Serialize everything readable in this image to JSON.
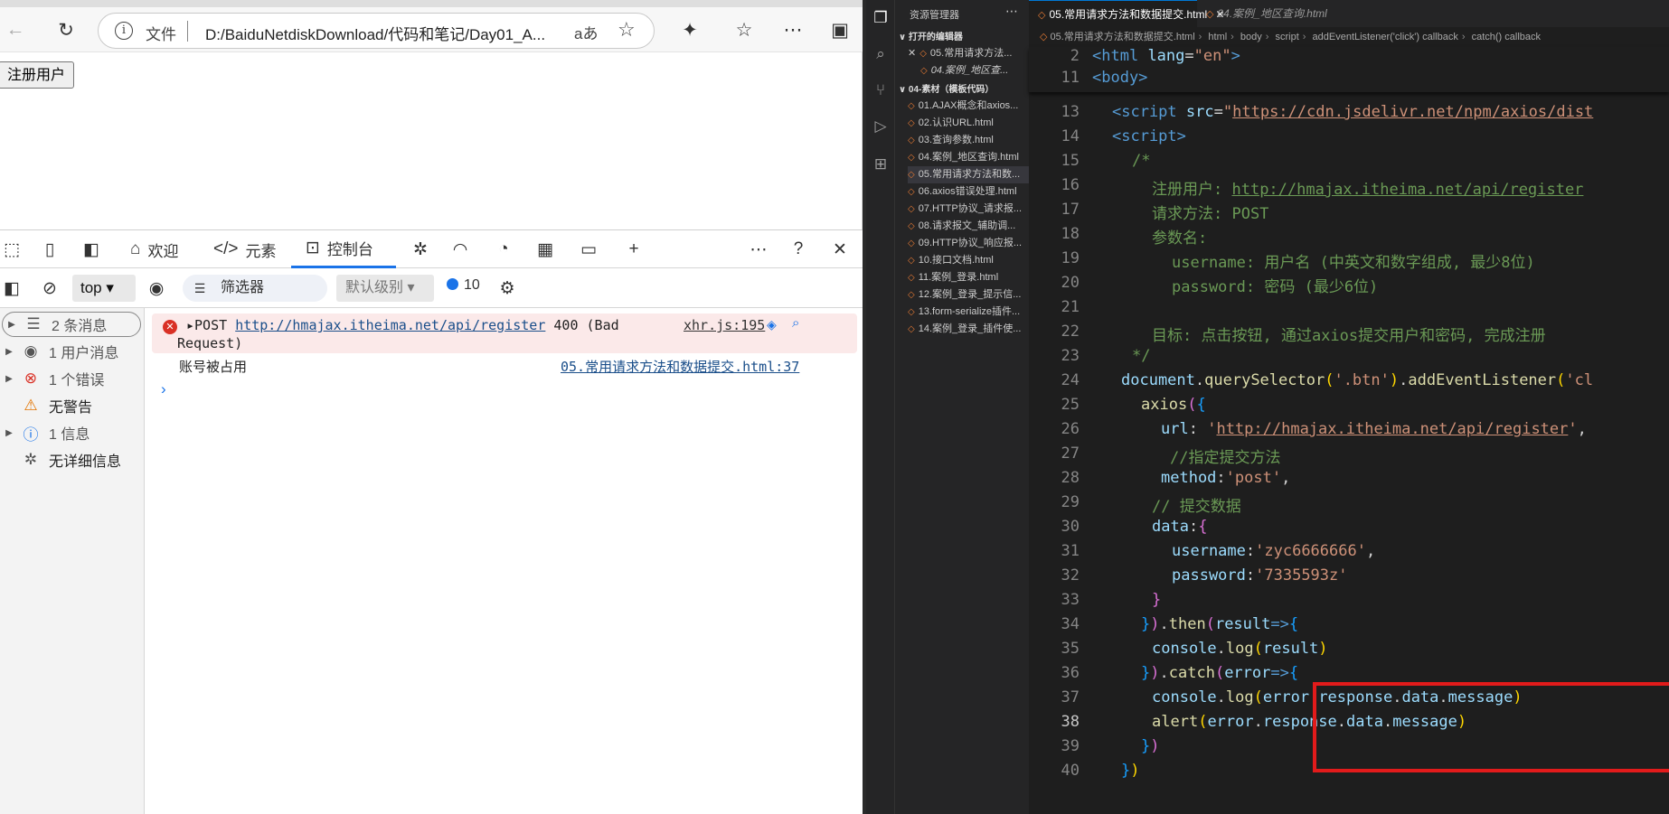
{
  "browser": {
    "address": {
      "label": "文件",
      "url": "D:/BaiduNetdiskDownload/代码和笔记/Day01_A...",
      "read_aloud": "aあ"
    },
    "page": {
      "button_label": "注册用户"
    }
  },
  "devtools": {
    "tabs": [
      {
        "label": "欢迎"
      },
      {
        "label": "元素"
      },
      {
        "label": "控制台"
      }
    ],
    "filter": {
      "context": "top",
      "filter_placeholder": "筛选器",
      "level": "默认级别",
      "count": "10"
    },
    "sidebar": [
      {
        "label": "2 条消息"
      },
      {
        "label": "1 用户消息"
      },
      {
        "label": "1 个错误"
      },
      {
        "label": "无警告"
      },
      {
        "label": "1 信息"
      },
      {
        "label": "无详细信息"
      }
    ],
    "console": {
      "error": {
        "method": "POST",
        "url": "http://hmajax.itheima.net/api/register",
        "status": "400 (Bad",
        "status2": "Request)",
        "source": "xhr.js:195"
      },
      "log": {
        "message": "账号被占用",
        "source": "05.常用请求方法和数据提交.html:37"
      }
    }
  },
  "vscode": {
    "explorer": {
      "title": "资源管理器",
      "open_editors": "打开的编辑器",
      "open_files": [
        {
          "name": "05.常用请求方法..."
        },
        {
          "name": "04.案例_地区查..."
        }
      ],
      "folder": "04-素材（模板代码）",
      "files": [
        {
          "name": "01.AJAX概念和axios..."
        },
        {
          "name": "02.认识URL.html"
        },
        {
          "name": "03.查询参数.html"
        },
        {
          "name": "04.案例_地区查询.html"
        },
        {
          "name": "05.常用请求方法和数..."
        },
        {
          "name": "06.axios错误处理.html"
        },
        {
          "name": "07.HTTP协议_请求报..."
        },
        {
          "name": "08.请求报文_辅助调..."
        },
        {
          "name": "09.HTTP协议_响应报..."
        },
        {
          "name": "10.接口文档.html"
        },
        {
          "name": "11.案例_登录.html"
        },
        {
          "name": "12.案例_登录_提示信..."
        },
        {
          "name": "13.form-serialize插件..."
        },
        {
          "name": "14.案例_登录_插件使..."
        }
      ]
    },
    "tabs": [
      {
        "label": "05.常用请求方法和数据提交.html"
      },
      {
        "label": "04.案例_地区查询.html"
      }
    ],
    "breadcrumb": [
      "05.常用请求方法和数据提交.html",
      "html",
      "body",
      "script",
      "addEventListener('click') callback",
      "catch() callback"
    ],
    "code": {
      "l13_src": "https://cdn.jsdelivr.net/npm/axios/dist",
      "l16": "注册用户: ",
      "l16_url": "http://hmajax.itheima.net/api/register",
      "l17": "请求方法: POST",
      "l18": "参数名:",
      "l19": "username: 用户名 (中英文和数字组成, 最少8位)",
      "l20": "password: 密码 (最少6位)",
      "l22": "目标: 点击按钮, 通过axios提交用户和密码, 完成注册",
      "l24_sel": "'.btn'",
      "l24_evt": "'cl",
      "l26_url": "http://hmajax.itheima.net/api/register",
      "l27": "//指定提交方法",
      "l28_val": "'post'",
      "l29": "// 提交数据",
      "l31_val": "'zyc6666666'",
      "l32_val": "'7335593z'"
    }
  },
  "colors": {
    "highlight_box": "#e21b1b",
    "console_tab_accent": "#1a73e8",
    "error_bg": "#fbe9e9"
  }
}
